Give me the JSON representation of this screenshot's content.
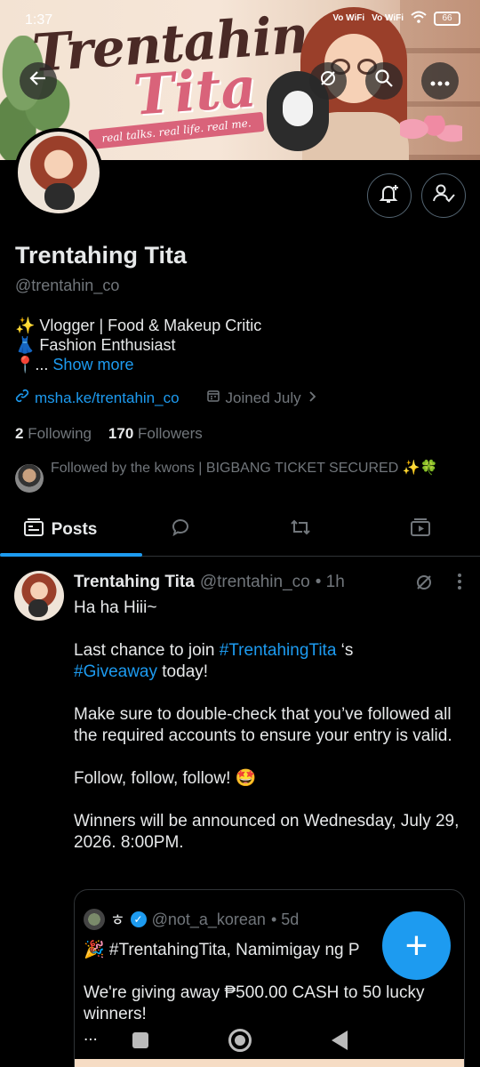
{
  "status_bar": {
    "time": "1:37",
    "net1": "Vo WiFi",
    "net2": "Vo WiFi",
    "battery": "66"
  },
  "banner": {
    "title_line1": "Trentahing",
    "title_line2": "Tita",
    "tagline": "real talks. real life. real me."
  },
  "profile": {
    "name": "Trentahing Tita",
    "handle": "@trentahin_co",
    "bio_line1": "✨ Vlogger | Food & Makeup Critic",
    "bio_line2": "👗 Fashion Enthusiast",
    "bio_line3_prefix": "📍... ",
    "show_more": "Show more",
    "link": "msha.ke/trentahin_co",
    "joined": "Joined July",
    "following_count": "2",
    "following_label": "Following",
    "followers_count": "170",
    "followers_label": "Followers",
    "followed_by": "Followed by the kwons | BIGBANG TICKET SECURED ✨🍀"
  },
  "tabs": {
    "posts": "Posts"
  },
  "post": {
    "name": "Trentahing Tita",
    "handle": "@trentahin_co",
    "time": "• 1h",
    "line1": "Ha ha Hiii~",
    "p2_pre": "Last chance to join ",
    "p2_hash1": "#TrentahingTita",
    "p2_mid": " ‘s",
    "p2_hash2": "#Giveaway",
    "p2_post": " today!",
    "p3": "Make sure to double-check that you’ve followed all the required accounts to ensure your entry is valid.",
    "p4": "Follow, follow, follow! 🤩",
    "p5": "Winners will be announced on Wednesday, July 29, 2026. 8:00PM."
  },
  "quote": {
    "name": "ㅎ",
    "handle": "@not_a_korean",
    "time": "• 5d",
    "line1": "🎉 #TrentahingTita, Namimigay ng P",
    "line2": "We're giving away ₱500.00 CASH to 50 lucky winners!",
    "line3": "..."
  },
  "fab": {
    "label": "+"
  }
}
